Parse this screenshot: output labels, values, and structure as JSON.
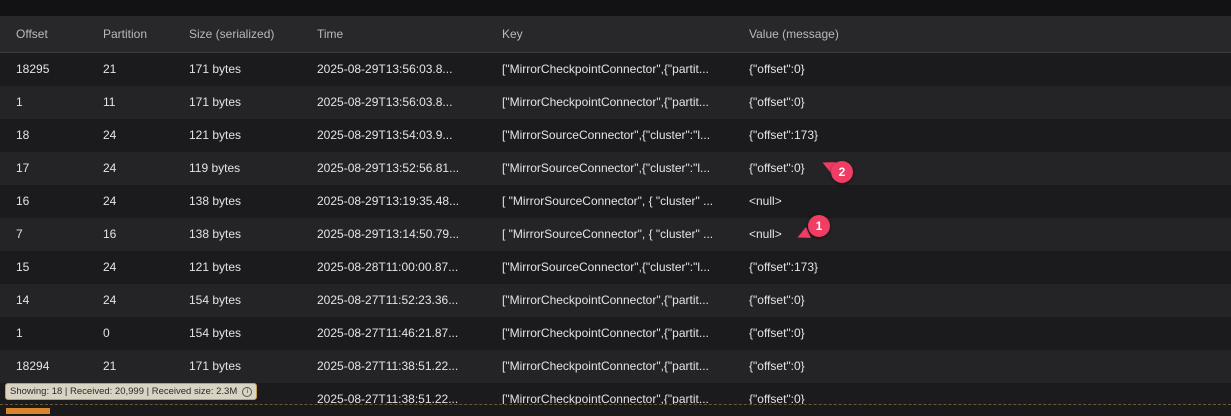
{
  "columns": {
    "offset": "Offset",
    "partition": "Partition",
    "size": "Size (serialized)",
    "time": "Time",
    "key": "Key",
    "value": "Value (message)"
  },
  "rows": [
    {
      "offset": "18295",
      "partition": "21",
      "size": "171 bytes",
      "time": "2025-08-29T13:56:03.8...",
      "key": "[\"MirrorCheckpointConnector\",{\"partit...",
      "value": "{\"offset\":0}"
    },
    {
      "offset": "1",
      "partition": "11",
      "size": "171 bytes",
      "time": "2025-08-29T13:56:03.8...",
      "key": "[\"MirrorCheckpointConnector\",{\"partit...",
      "value": "{\"offset\":0}"
    },
    {
      "offset": "18",
      "partition": "24",
      "size": "121 bytes",
      "time": "2025-08-29T13:54:03.9...",
      "key": "[\"MirrorSourceConnector\",{\"cluster\":\"l...",
      "value": "{\"offset\":173}"
    },
    {
      "offset": "17",
      "partition": "24",
      "size": "119 bytes",
      "time": "2025-08-29T13:52:56.81...",
      "key": "[\"MirrorSourceConnector\",{\"cluster\":\"l...",
      "value": "{\"offset\":0}"
    },
    {
      "offset": "16",
      "partition": "24",
      "size": "138 bytes",
      "time": "2025-08-29T13:19:35.48...",
      "key": "[ \"MirrorSourceConnector\", { \"cluster\" ...",
      "value": "<null>"
    },
    {
      "offset": "7",
      "partition": "16",
      "size": "138 bytes",
      "time": "2025-08-29T13:14:50.79...",
      "key": "[ \"MirrorSourceConnector\", { \"cluster\" ...",
      "value": "<null>"
    },
    {
      "offset": "15",
      "partition": "24",
      "size": "121 bytes",
      "time": "2025-08-28T11:00:00.87...",
      "key": "[\"MirrorSourceConnector\",{\"cluster\":\"l...",
      "value": "{\"offset\":173}"
    },
    {
      "offset": "14",
      "partition": "24",
      "size": "154 bytes",
      "time": "2025-08-27T11:52:23.36...",
      "key": "[\"MirrorCheckpointConnector\",{\"partit...",
      "value": "{\"offset\":0}"
    },
    {
      "offset": "1",
      "partition": "0",
      "size": "154 bytes",
      "time": "2025-08-27T11:46:21.87...",
      "key": "[\"MirrorCheckpointConnector\",{\"partit...",
      "value": "{\"offset\":0}"
    },
    {
      "offset": "18294",
      "partition": "21",
      "size": "171 bytes",
      "time": "2025-08-27T11:38:51.22...",
      "key": "[\"MirrorCheckpointConnector\",{\"partit...",
      "value": "{\"offset\":0}"
    },
    {
      "offset": "",
      "partition": "",
      "size": "",
      "time": "2025-08-27T11:38:51.22...",
      "key": "[\"MirrorCheckpointConnector\",{\"partit...",
      "value": "{\"offset\":0}"
    }
  ],
  "markers": {
    "one": "1",
    "two": "2"
  },
  "status": {
    "text": "Showing: 18 | Received: 20,999 | Received size: 2.3M"
  },
  "colors": {
    "marker": "#ef3d63",
    "status_border": "#c89d4d",
    "accent": "#d9862d"
  }
}
